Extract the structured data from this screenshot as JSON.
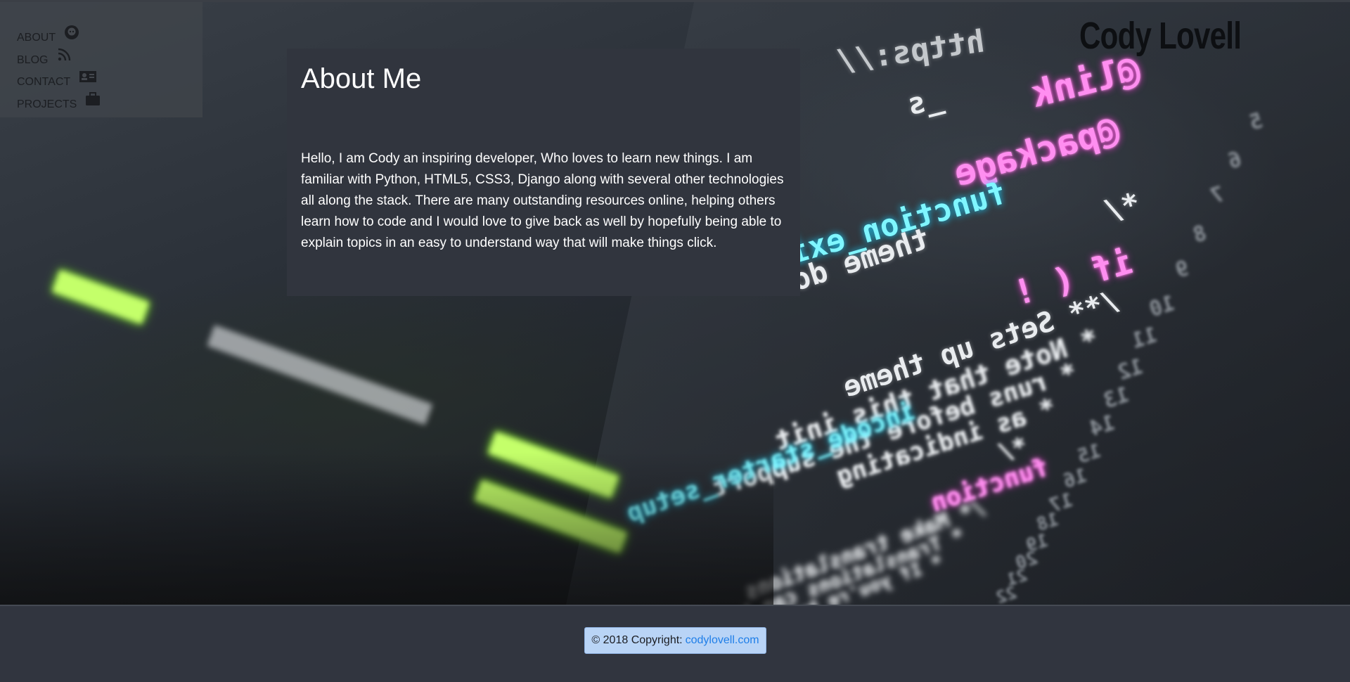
{
  "nav": {
    "items": [
      {
        "label": "ABOUT",
        "icon": "github-octocat-icon"
      },
      {
        "label": "BLOG",
        "icon": "rss-icon"
      },
      {
        "label": "CONTACT",
        "icon": "contact-card-icon"
      },
      {
        "label": "PROJECTS",
        "icon": "briefcase-icon"
      }
    ]
  },
  "brand": {
    "name": "Cody Lovell"
  },
  "about": {
    "title": "About Me",
    "body": "Hello, I am Cody an inspiring developer, Who loves to learn new things. I am familiar with Python, HTML5, CSS3, Django along with several other technologies all along the stack. There are many outstanding resources online, helping others learn how to code and I would love to give back as well by hopefully being able to explain topics in an easy to understand way that will make things click."
  },
  "footer": {
    "copyright_text": "© 2018 Copyright:",
    "link_text": "codylovell.com"
  },
  "background_code": {
    "line_numbers": [
      "5",
      "6",
      "7",
      "8",
      "9",
      "10",
      "11",
      "12",
      "13",
      "14",
      "15",
      "16",
      "17",
      "18",
      "19",
      "20",
      "21",
      "22"
    ],
    "lines": [
      "https://",
      "@link",
      "_s",
      "@package",
      "*/",
      "function_exists",
      "if ( !",
      "theme do",
      "/** Sets up theme",
      "* Note that this init",
      "* runs before the support",
      "* as indicating",
      "*/",
      "function",
      "incode_starter_setup",
      "/* Make translations",
      "* Translations can be available",
      "* If you're building a theme"
    ]
  }
}
